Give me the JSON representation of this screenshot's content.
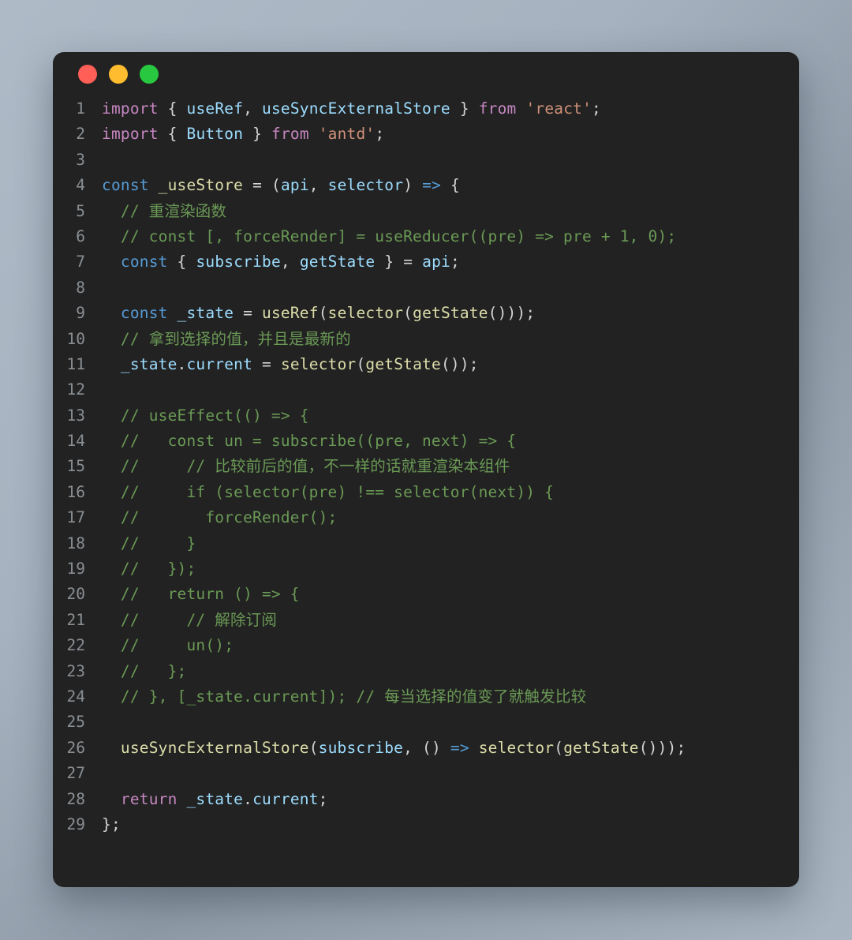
{
  "window": {
    "background_color": "#222222",
    "page_background": "#a6b2bf",
    "traffic_lights": [
      {
        "name": "close",
        "color": "#ff5f56"
      },
      {
        "name": "minimize",
        "color": "#febc2e"
      },
      {
        "name": "maximize",
        "color": "#28c840"
      }
    ]
  },
  "editor": {
    "language": "javascript",
    "theme": "dark-plus",
    "font_size": "19.5px",
    "colors": {
      "keyword": "#c586c0",
      "control": "#569cd6",
      "function": "#dcdcaa",
      "variable": "#9cdcfe",
      "string": "#ce9178",
      "comment": "#6a9955",
      "number": "#b5cea8",
      "plain": "#d4d4d4",
      "gutter": "#8a8f94"
    },
    "lines": [
      {
        "n": "1",
        "tokens": [
          {
            "t": "import",
            "c": "kw"
          },
          {
            "t": " ",
            "c": "plain"
          },
          {
            "t": "{",
            "c": "plain"
          },
          {
            "t": " ",
            "c": "plain"
          },
          {
            "t": "useRef",
            "c": "var"
          },
          {
            "t": ",",
            "c": "plain"
          },
          {
            "t": " ",
            "c": "plain"
          },
          {
            "t": "useSyncExternalStore",
            "c": "var"
          },
          {
            "t": " ",
            "c": "plain"
          },
          {
            "t": "}",
            "c": "plain"
          },
          {
            "t": " ",
            "c": "plain"
          },
          {
            "t": "from",
            "c": "kw"
          },
          {
            "t": " ",
            "c": "plain"
          },
          {
            "t": "'react'",
            "c": "str"
          },
          {
            "t": ";",
            "c": "plain"
          }
        ]
      },
      {
        "n": "2",
        "tokens": [
          {
            "t": "import",
            "c": "kw"
          },
          {
            "t": " ",
            "c": "plain"
          },
          {
            "t": "{",
            "c": "plain"
          },
          {
            "t": " ",
            "c": "plain"
          },
          {
            "t": "Button",
            "c": "var"
          },
          {
            "t": " ",
            "c": "plain"
          },
          {
            "t": "}",
            "c": "plain"
          },
          {
            "t": " ",
            "c": "plain"
          },
          {
            "t": "from",
            "c": "kw"
          },
          {
            "t": " ",
            "c": "plain"
          },
          {
            "t": "'antd'",
            "c": "str"
          },
          {
            "t": ";",
            "c": "plain"
          }
        ]
      },
      {
        "n": "3",
        "tokens": []
      },
      {
        "n": "4",
        "tokens": [
          {
            "t": "const",
            "c": "ctrl"
          },
          {
            "t": " ",
            "c": "plain"
          },
          {
            "t": "_useStore",
            "c": "fn"
          },
          {
            "t": " ",
            "c": "plain"
          },
          {
            "t": "=",
            "c": "plain"
          },
          {
            "t": " ",
            "c": "plain"
          },
          {
            "t": "(",
            "c": "plain"
          },
          {
            "t": "api",
            "c": "var"
          },
          {
            "t": ",",
            "c": "plain"
          },
          {
            "t": " ",
            "c": "plain"
          },
          {
            "t": "selector",
            "c": "var"
          },
          {
            "t": ")",
            "c": "plain"
          },
          {
            "t": " ",
            "c": "plain"
          },
          {
            "t": "=>",
            "c": "arrow"
          },
          {
            "t": " ",
            "c": "plain"
          },
          {
            "t": "{",
            "c": "plain"
          }
        ]
      },
      {
        "n": "5",
        "tokens": [
          {
            "t": "  // 重渲染函数",
            "c": "cmt"
          }
        ]
      },
      {
        "n": "6",
        "tokens": [
          {
            "t": "  // const [, forceRender] = useReducer((pre) => pre + 1, 0);",
            "c": "cmt"
          }
        ]
      },
      {
        "n": "7",
        "tokens": [
          {
            "t": "  ",
            "c": "plain"
          },
          {
            "t": "const",
            "c": "ctrl"
          },
          {
            "t": " ",
            "c": "plain"
          },
          {
            "t": "{",
            "c": "plain"
          },
          {
            "t": " ",
            "c": "plain"
          },
          {
            "t": "subscribe",
            "c": "var"
          },
          {
            "t": ",",
            "c": "plain"
          },
          {
            "t": " ",
            "c": "plain"
          },
          {
            "t": "getState",
            "c": "var"
          },
          {
            "t": " ",
            "c": "plain"
          },
          {
            "t": "}",
            "c": "plain"
          },
          {
            "t": " ",
            "c": "plain"
          },
          {
            "t": "=",
            "c": "plain"
          },
          {
            "t": " ",
            "c": "plain"
          },
          {
            "t": "api",
            "c": "var"
          },
          {
            "t": ";",
            "c": "plain"
          }
        ]
      },
      {
        "n": "8",
        "tokens": []
      },
      {
        "n": "9",
        "tokens": [
          {
            "t": "  ",
            "c": "plain"
          },
          {
            "t": "const",
            "c": "ctrl"
          },
          {
            "t": " ",
            "c": "plain"
          },
          {
            "t": "_state",
            "c": "var"
          },
          {
            "t": " ",
            "c": "plain"
          },
          {
            "t": "=",
            "c": "plain"
          },
          {
            "t": " ",
            "c": "plain"
          },
          {
            "t": "useRef",
            "c": "fn"
          },
          {
            "t": "(",
            "c": "plain"
          },
          {
            "t": "selector",
            "c": "fn"
          },
          {
            "t": "(",
            "c": "plain"
          },
          {
            "t": "getState",
            "c": "fn"
          },
          {
            "t": "()));",
            "c": "plain"
          }
        ]
      },
      {
        "n": "10",
        "tokens": [
          {
            "t": "  // 拿到选择的值，并且是最新的",
            "c": "cmt"
          }
        ]
      },
      {
        "n": "11",
        "tokens": [
          {
            "t": "  ",
            "c": "plain"
          },
          {
            "t": "_state",
            "c": "var"
          },
          {
            "t": ".",
            "c": "plain"
          },
          {
            "t": "current",
            "c": "var"
          },
          {
            "t": " ",
            "c": "plain"
          },
          {
            "t": "=",
            "c": "plain"
          },
          {
            "t": " ",
            "c": "plain"
          },
          {
            "t": "selector",
            "c": "fn"
          },
          {
            "t": "(",
            "c": "plain"
          },
          {
            "t": "getState",
            "c": "fn"
          },
          {
            "t": "());",
            "c": "plain"
          }
        ]
      },
      {
        "n": "12",
        "tokens": []
      },
      {
        "n": "13",
        "tokens": [
          {
            "t": "  // useEffect(() => {",
            "c": "cmt"
          }
        ]
      },
      {
        "n": "14",
        "tokens": [
          {
            "t": "  //   const un = subscribe((pre, next) => {",
            "c": "cmt"
          }
        ]
      },
      {
        "n": "15",
        "tokens": [
          {
            "t": "  //     // 比较前后的值，不一样的话就重渲染本组件",
            "c": "cmt"
          }
        ]
      },
      {
        "n": "16",
        "tokens": [
          {
            "t": "  //     if (selector(pre) !== selector(next)) {",
            "c": "cmt"
          }
        ]
      },
      {
        "n": "17",
        "tokens": [
          {
            "t": "  //       forceRender();",
            "c": "cmt"
          }
        ]
      },
      {
        "n": "18",
        "tokens": [
          {
            "t": "  //     }",
            "c": "cmt"
          }
        ]
      },
      {
        "n": "19",
        "tokens": [
          {
            "t": "  //   });",
            "c": "cmt"
          }
        ]
      },
      {
        "n": "20",
        "tokens": [
          {
            "t": "  //   return () => {",
            "c": "cmt"
          }
        ]
      },
      {
        "n": "21",
        "tokens": [
          {
            "t": "  //     // 解除订阅",
            "c": "cmt"
          }
        ]
      },
      {
        "n": "22",
        "tokens": [
          {
            "t": "  //     un();",
            "c": "cmt"
          }
        ]
      },
      {
        "n": "23",
        "tokens": [
          {
            "t": "  //   };",
            "c": "cmt"
          }
        ]
      },
      {
        "n": "24",
        "tokens": [
          {
            "t": "  // }, [_state.current]); // 每当选择的值变了就触发比较",
            "c": "cmt"
          }
        ]
      },
      {
        "n": "25",
        "tokens": []
      },
      {
        "n": "26",
        "tokens": [
          {
            "t": "  ",
            "c": "plain"
          },
          {
            "t": "useSyncExternalStore",
            "c": "fn"
          },
          {
            "t": "(",
            "c": "plain"
          },
          {
            "t": "subscribe",
            "c": "var"
          },
          {
            "t": ",",
            "c": "plain"
          },
          {
            "t": " ",
            "c": "plain"
          },
          {
            "t": "()",
            "c": "plain"
          },
          {
            "t": " ",
            "c": "plain"
          },
          {
            "t": "=>",
            "c": "arrow"
          },
          {
            "t": " ",
            "c": "plain"
          },
          {
            "t": "selector",
            "c": "fn"
          },
          {
            "t": "(",
            "c": "plain"
          },
          {
            "t": "getState",
            "c": "fn"
          },
          {
            "t": "()));",
            "c": "plain"
          }
        ]
      },
      {
        "n": "27",
        "tokens": []
      },
      {
        "n": "28",
        "tokens": [
          {
            "t": "  ",
            "c": "plain"
          },
          {
            "t": "return",
            "c": "kw"
          },
          {
            "t": " ",
            "c": "plain"
          },
          {
            "t": "_state",
            "c": "var"
          },
          {
            "t": ".",
            "c": "plain"
          },
          {
            "t": "current",
            "c": "var"
          },
          {
            "t": ";",
            "c": "plain"
          }
        ]
      },
      {
        "n": "29",
        "tokens": [
          {
            "t": "};",
            "c": "plain"
          }
        ]
      }
    ]
  }
}
